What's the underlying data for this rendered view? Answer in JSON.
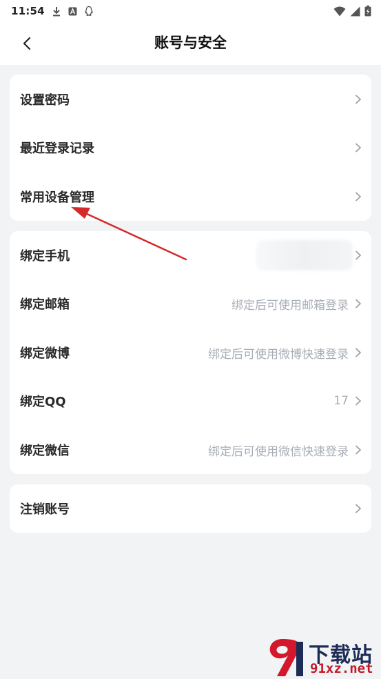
{
  "status_bar": {
    "time": "11:54"
  },
  "header": {
    "title": "账号与安全"
  },
  "group1": [
    {
      "label": "设置密码",
      "value": ""
    },
    {
      "label": "最近登录记录",
      "value": ""
    },
    {
      "label": "常用设备管理",
      "value": ""
    }
  ],
  "group2": [
    {
      "label": "绑定手机",
      "value": ""
    },
    {
      "label": "绑定邮箱",
      "value": "绑定后可使用邮箱登录"
    },
    {
      "label": "绑定微博",
      "value": "绑定后可使用微博快速登录"
    },
    {
      "label": "绑定QQ",
      "value": "17"
    },
    {
      "label": "绑定微信",
      "value": "绑定后可使用微信快速登录"
    }
  ],
  "group3": [
    {
      "label": "注销账号",
      "value": ""
    }
  ],
  "watermark": {
    "brand": "下载站",
    "url": "91xz.net"
  },
  "colors": {
    "page_bg": "#f2f3f5",
    "card_bg": "#ffffff",
    "arrow": "#d42a2a",
    "hint": "#a8aeb6"
  }
}
